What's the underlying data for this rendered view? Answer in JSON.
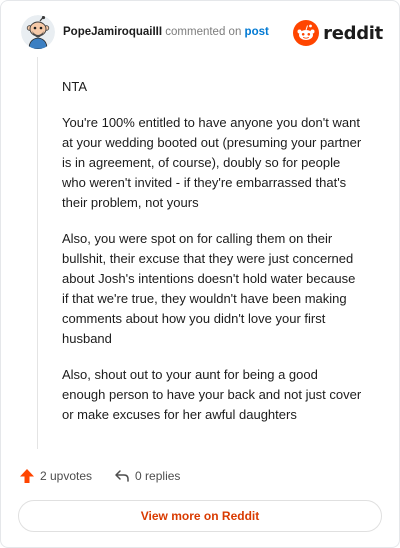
{
  "header": {
    "author": "PopeJamiroquaiIII",
    "commented_text": "commented on",
    "post_label": "post",
    "brand_name": "reddit",
    "avatar_icon": "snoo-avatar-icon",
    "brand_icon": "reddit-logo-icon"
  },
  "comment": {
    "paragraphs": [
      "NTA",
      "You're 100% entitled to have anyone you don't want at your wedding booted out (presuming your partner is in agreement, of course), doubly so for people who weren't invited - if they're embarrassed that's their problem, not yours",
      "Also, you were spot on for calling them on their bullshit, their excuse that they were just concerned about Josh's intentions doesn't hold water because if that we're true, they wouldn't have been making comments about how you didn't love your first husband",
      "Also, shout out to your aunt for being a good enough person to have your back and not just cover or make excuses for her awful daughters"
    ]
  },
  "actions": {
    "upvotes_label": "2 upvotes",
    "replies_label": "0 replies",
    "upvote_icon": "upvote-arrow-icon",
    "reply_icon": "reply-arrow-icon"
  },
  "footer": {
    "view_more_label": "View more on Reddit"
  },
  "colors": {
    "brand_orange": "#ff4500",
    "link_blue": "#0079d3",
    "view_more_text": "#d93a00",
    "text_primary": "#1c1c1c",
    "text_muted": "#7c7c7c"
  }
}
